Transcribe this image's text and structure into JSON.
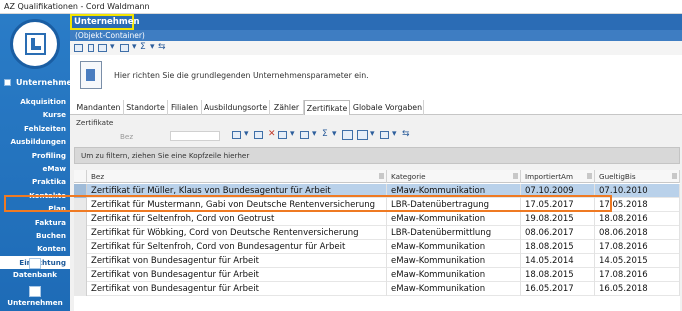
{
  "window": {
    "title": "AZ Qualifikationen - Cord Waldmann"
  },
  "sidebar": {
    "header": "Unternehmen",
    "items": [
      {
        "label": "Akquisition"
      },
      {
        "label": "Kurse"
      },
      {
        "label": "Fehlzeiten"
      },
      {
        "label": "Ausbildungen"
      },
      {
        "label": "Profiling"
      },
      {
        "label": "eMaw"
      },
      {
        "label": "Praktika"
      },
      {
        "label": "Kontakte"
      },
      {
        "label": "Plan"
      },
      {
        "label": "Faktura"
      },
      {
        "label": "Buchen"
      },
      {
        "label": "Konten"
      },
      {
        "label": "Einrichtung"
      }
    ],
    "buttons": [
      {
        "label": "Datenbank"
      },
      {
        "label": "Unternehmen"
      }
    ]
  },
  "main": {
    "title": "Unternehmen",
    "subtitle": "(Objekt-Container)",
    "hint": "Hier richten Sie die grundlegenden Unternehmensparameter ein.",
    "tabs": [
      {
        "label": "Mandanten"
      },
      {
        "label": "Standorte"
      },
      {
        "label": "Filialen"
      },
      {
        "label": "Ausbildungsorte"
      },
      {
        "label": "Zähler"
      },
      {
        "label": "Zertifikate"
      },
      {
        "label": "Globale Vorgaben"
      }
    ],
    "panel_title": "Zertifikate",
    "filter_label": "Bez",
    "group_hint": "Um zu filtern, ziehen Sie eine Kopfzeile hierher",
    "columns": [
      "Bez",
      "Kategorie",
      "ImportiertAm",
      "GueltigBis"
    ],
    "rows": [
      [
        "Zertifikat für Müller, Klaus von Bundesagentur für Arbeit",
        "eMaw-Kommunikation",
        "07.10.2009",
        "07.10.2010"
      ],
      [
        "Zertifikat für Mustermann, Gabi von Deutsche Rentenversicherung",
        "LBR-Datenübertragung",
        "17.05.2017",
        "17.05.2018"
      ],
      [
        "Zertifikat für Seltenfroh, Cord von Geotrust",
        "eMaw-Kommunikation",
        "19.08.2015",
        "18.08.2016"
      ],
      [
        "Zertifikat für Wöbking, Cord von Deutsche Rentenversicherung",
        "LBR-Datenübermittlung",
        "08.06.2017",
        "08.06.2018"
      ],
      [
        "Zertifikat für Seltenfroh, Cord von Bundesagentur für Arbeit",
        "eMaw-Kommunikation",
        "18.08.2015",
        "17.08.2016"
      ],
      [
        "Zertifikat von Bundesagentur für Arbeit",
        "eMaw-Kommunikation",
        "14.05.2014",
        "14.05.2015"
      ],
      [
        "Zertifikat von Bundesagentur für Arbeit",
        "eMaw-Kommunikation",
        "18.08.2015",
        "17.08.2016"
      ],
      [
        "Zertifikat von Bundesagentur für Arbeit",
        "eMaw-Kommunikation",
        "16.05.2017",
        "16.05.2018"
      ]
    ],
    "selected_row": 0,
    "highlighted_row": 1
  },
  "colors": {
    "highlight": "#ef7a23",
    "title_frame": "#f2e400",
    "sidebar": "#2a7cc7",
    "selection": "#b9d1ea"
  }
}
